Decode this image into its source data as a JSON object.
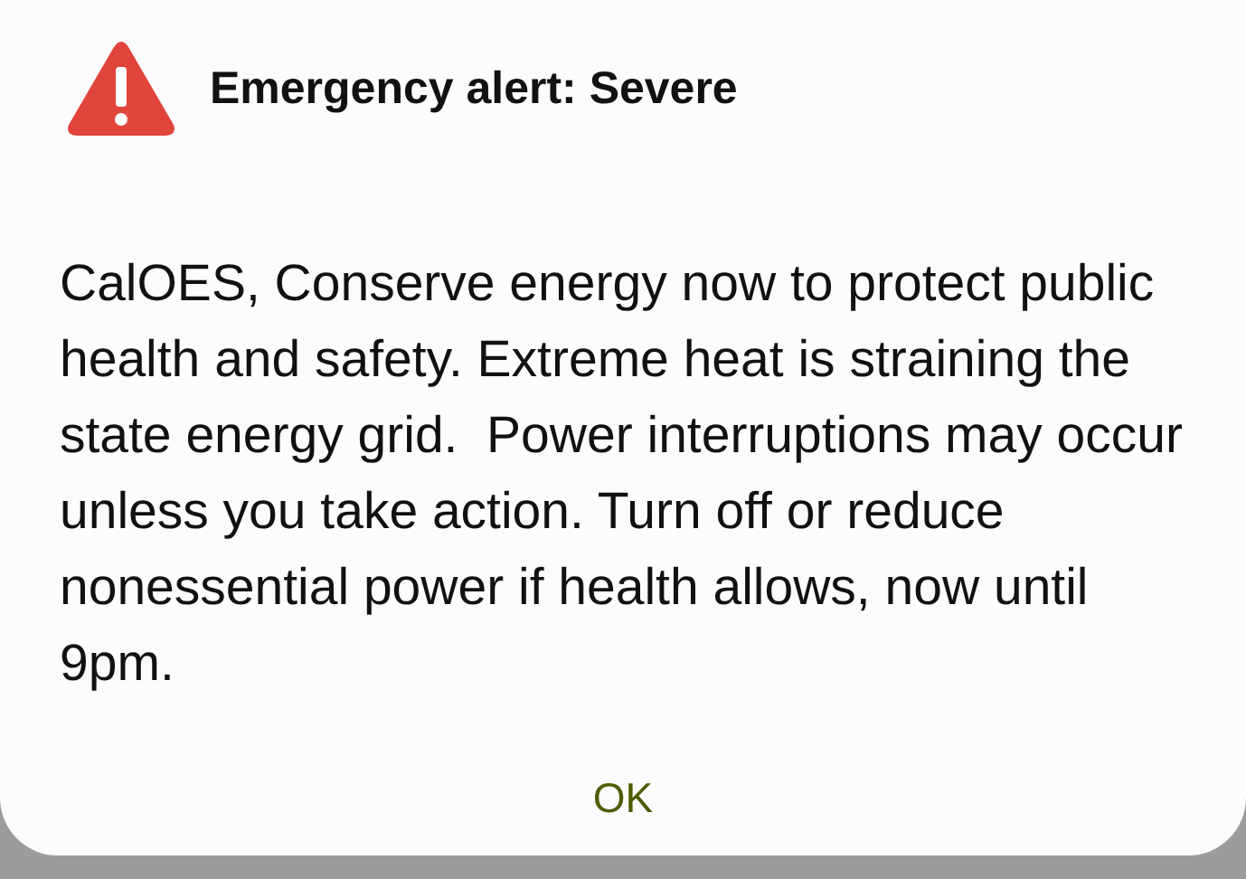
{
  "dialog": {
    "title": "Emergency alert: Severe",
    "message": "CalOES, Conserve energy now to protect public health and safety. Extreme heat is straining the state energy grid.  Power interruptions may occur unless you take action. Turn off or reduce nonessential power if health allows, now until 9pm.",
    "buttons": [
      "OK"
    ]
  }
}
